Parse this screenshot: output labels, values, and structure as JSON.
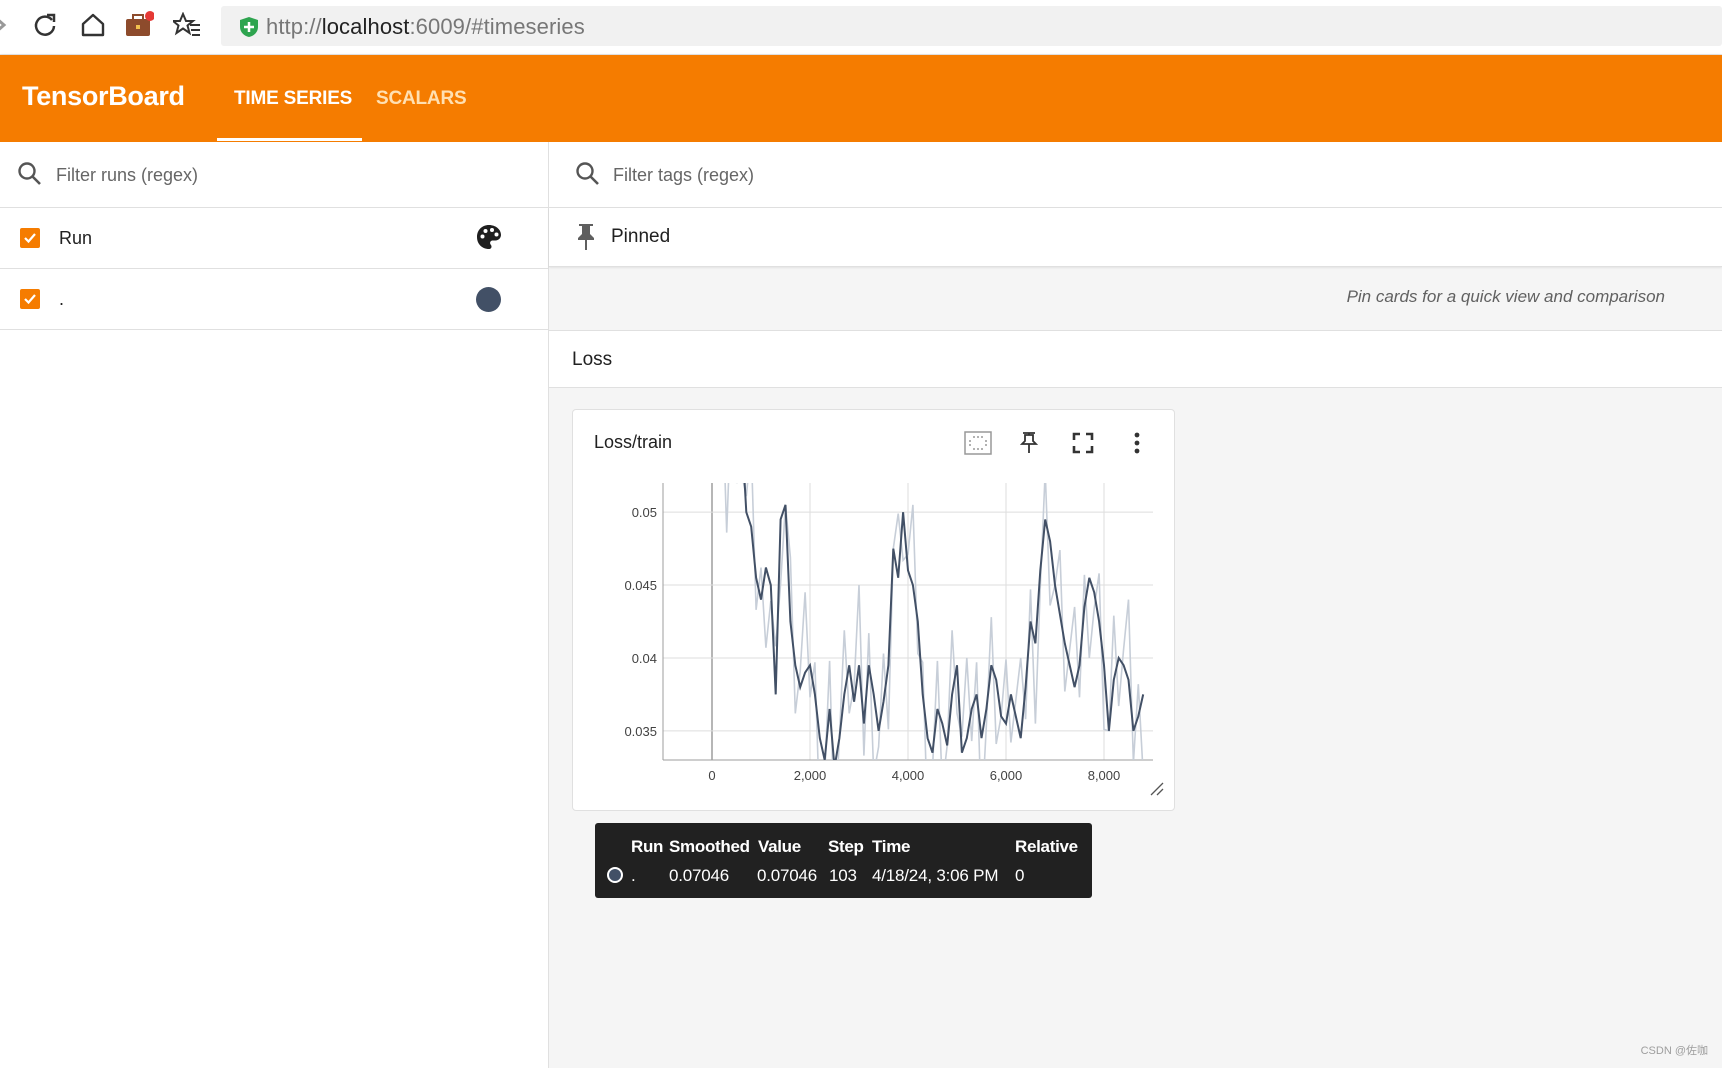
{
  "browser": {
    "url_prefix": "http://",
    "url_host": "localhost",
    "url_suffix": ":6009/#timeseries",
    "icons": [
      "forward-icon",
      "reload-icon",
      "home-icon",
      "extension-icon",
      "bookmarks-icon",
      "secure-shield-icon"
    ]
  },
  "header": {
    "logo": "TensorBoard",
    "tabs": [
      {
        "label": "TIME SERIES",
        "active": true
      },
      {
        "label": "SCALARS",
        "active": false
      }
    ],
    "accent_color": "#f57c00"
  },
  "sidebar": {
    "filter_placeholder": "Filter runs (regex)",
    "runs": [
      {
        "label": "Run",
        "checked": true,
        "icon": "palette-icon"
      },
      {
        "label": ".",
        "checked": true,
        "color": "#425066"
      }
    ]
  },
  "main": {
    "filter_placeholder": "Filter tags (regex)",
    "pinned_label": "Pinned",
    "pin_hint": "Pin cards for a quick view and comparison",
    "group_label": "Loss",
    "card": {
      "title": "Loss/train",
      "buttons": [
        "fit-domain-button",
        "pin-button",
        "fullscreen-button",
        "more-options-button"
      ]
    }
  },
  "chart_data": {
    "type": "line",
    "title": "Loss/train",
    "xlabel": "",
    "ylabel": "",
    "x_ticks": [
      "0",
      "2,000",
      "4,000",
      "6,000",
      "8,000"
    ],
    "y_ticks": [
      "0.035",
      "0.04",
      "0.045",
      "0.05"
    ],
    "xlim": [
      -1000,
      9000
    ],
    "ylim": [
      0.033,
      0.052
    ],
    "grid": true,
    "series": [
      {
        "name": ".",
        "color": "#425066",
        "x": [
          0,
          100,
          200,
          300,
          400,
          500,
          600,
          700,
          800,
          900,
          1000,
          1100,
          1200,
          1300,
          1400,
          1500,
          1600,
          1700,
          1800,
          1900,
          2000,
          2100,
          2200,
          2300,
          2400,
          2500,
          2600,
          2700,
          2800,
          2900,
          3000,
          3100,
          3200,
          3300,
          3400,
          3500,
          3600,
          3700,
          3800,
          3900,
          4000,
          4100,
          4200,
          4300,
          4400,
          4500,
          4600,
          4700,
          4800,
          4900,
          5000,
          5100,
          5200,
          5300,
          5400,
          5500,
          5600,
          5700,
          5800,
          5900,
          6000,
          6100,
          6200,
          6300,
          6400,
          6500,
          6600,
          6700,
          6800,
          6900,
          7000,
          7100,
          7200,
          7300,
          7400,
          7500,
          7600,
          7700,
          7800,
          7900,
          8000,
          8100,
          8200,
          8300,
          8400,
          8500,
          8600,
          8700,
          8800
        ],
        "values": [
          0.0705,
          0.06,
          0.056,
          0.053,
          0.058,
          0.052,
          0.056,
          0.05,
          0.049,
          0.0455,
          0.044,
          0.0462,
          0.045,
          0.0375,
          0.0495,
          0.0505,
          0.0425,
          0.0395,
          0.038,
          0.039,
          0.0395,
          0.0375,
          0.0345,
          0.033,
          0.0365,
          0.0325,
          0.0345,
          0.0375,
          0.0395,
          0.037,
          0.0395,
          0.0355,
          0.0395,
          0.0375,
          0.035,
          0.037,
          0.0395,
          0.0475,
          0.0455,
          0.05,
          0.046,
          0.045,
          0.0425,
          0.0375,
          0.0345,
          0.0335,
          0.0365,
          0.0355,
          0.034,
          0.0375,
          0.0395,
          0.0335,
          0.0345,
          0.0365,
          0.0375,
          0.0345,
          0.0365,
          0.0395,
          0.0385,
          0.036,
          0.0355,
          0.0375,
          0.036,
          0.0345,
          0.038,
          0.0425,
          0.041,
          0.046,
          0.0495,
          0.048,
          0.045,
          0.043,
          0.041,
          0.0395,
          0.038,
          0.0395,
          0.0435,
          0.0455,
          0.0445,
          0.0425,
          0.0395,
          0.035,
          0.0385,
          0.04,
          0.0395,
          0.0385,
          0.035,
          0.036,
          0.0375
        ]
      }
    ]
  },
  "tooltip": {
    "headers": [
      "Run",
      "Smoothed",
      "Value",
      "Step",
      "Time",
      "Relative"
    ],
    "row": {
      "run": ".",
      "smoothed": "0.07046",
      "value": "0.07046",
      "step": "103",
      "time": "4/18/24, 3:06 PM",
      "relative": "0"
    }
  },
  "watermark": "CSDN @佐咖"
}
